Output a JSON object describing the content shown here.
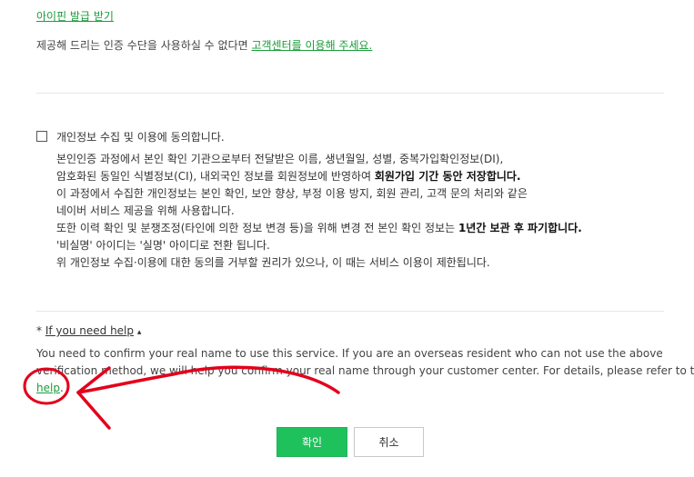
{
  "ipin_link": "아이핀 발급 받기",
  "notice": {
    "text": "제공해 드리는 인증 수단을 사용하실 수 없다면 ",
    "link": "고객센터를 이용해 주세요."
  },
  "consent": {
    "label": "개인정보 수집 및 이용에 동의합니다.",
    "lines": [
      {
        "text": "본인인증 과정에서 본인 확인 기관으로부터 전달받은 이름, 생년월일, 성별, 중복가입확인정보(DI),"
      },
      {
        "text": "암호화된 동일인 식별정보(CI), 내외국인 정보를 회원정보에 반영하여 ",
        "bold": "회원가입 기간 동안 저장합니다."
      },
      {
        "text": "이 과정에서 수집한 개인정보는 본인 확인, 보안 향상, 부정 이용 방지, 회원 관리, 고객 문의 처리와 같은"
      },
      {
        "text": "네이버 서비스 제공을 위해 사용합니다."
      },
      {
        "text": "또한 이력 확인 및 분쟁조정(타인에 의한 정보 변경 등)을 위해 변경 전 본인 확인 정보는 ",
        "bold": "1년간 보관 후 파기합니다."
      },
      {
        "text": "'비실명' 아이디는 '실명' 아이디로 전환 됩니다."
      },
      {
        "text": "위 개인정보 수집·이용에 대한 동의를 거부할 권리가 있으나, 이 때는 서비스 이용이 제한됩니다."
      }
    ]
  },
  "help": {
    "toggle_prefix": "* ",
    "toggle_label": "If you need help",
    "toggle_arrow": "▴",
    "line1": "You need to confirm your real name to use this service. If you are an overseas resident who can not use the above",
    "line2": "verification method, we will help you confirm your real name through your customer center. For details, please refer to the",
    "link": "help",
    "link_suffix": "."
  },
  "buttons": {
    "confirm": "확인",
    "cancel": "취소"
  },
  "colors": {
    "link": "#1a9d3a",
    "confirm_button": "#1fc15c",
    "annotation": "#e3001b"
  }
}
